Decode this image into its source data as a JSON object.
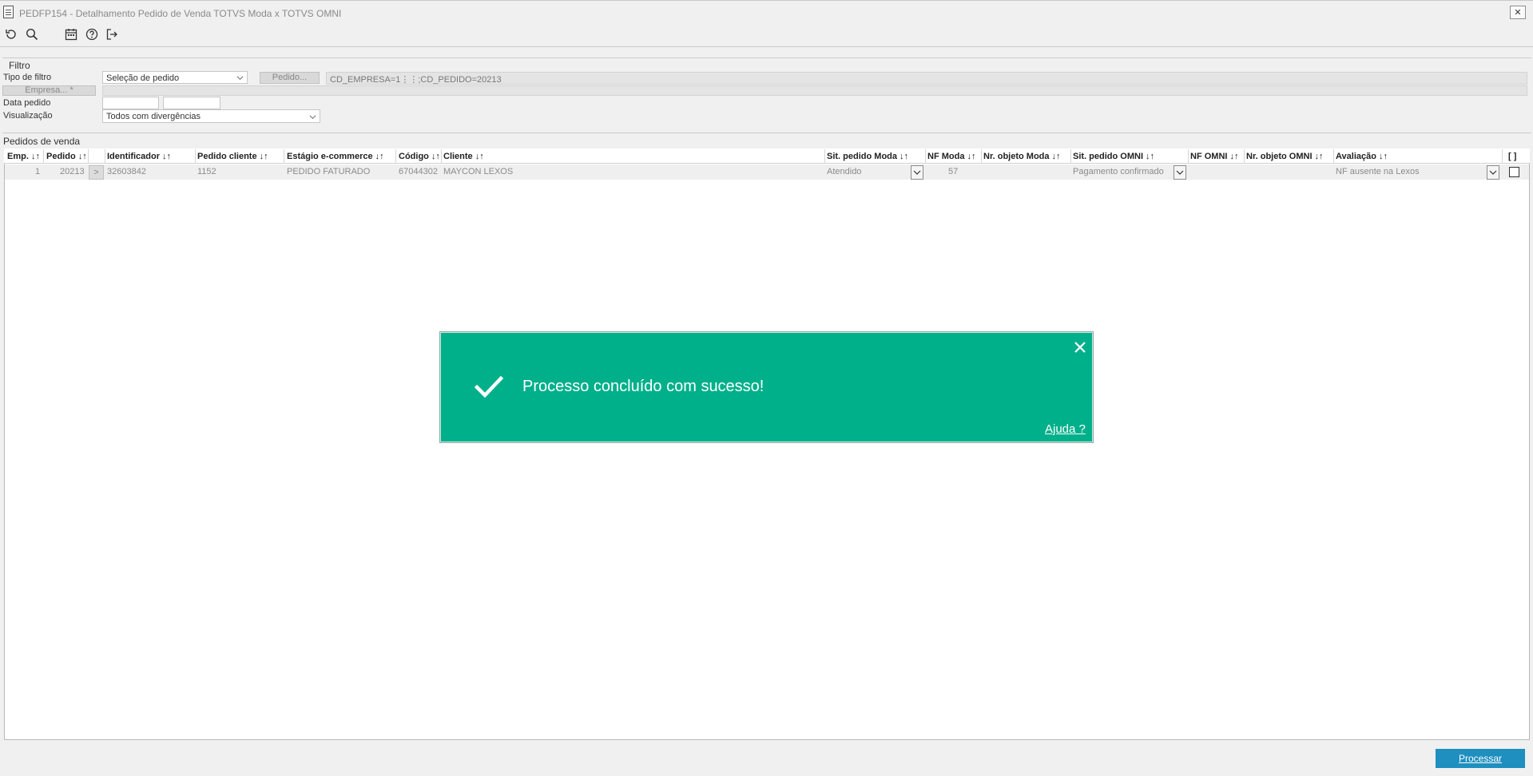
{
  "window": {
    "title": "PEDFP154 - Detalhamento Pedido de Venda TOTVS Moda x TOTVS OMNI",
    "close_glyph": "✕"
  },
  "toolbar": {
    "icons": [
      "refresh-icon",
      "search-icon",
      "calendar-icon",
      "help-circle-icon",
      "exit-icon"
    ]
  },
  "filter": {
    "section_title": "Filtro",
    "tipo_filtro_label": "Tipo de filtro",
    "tipo_filtro_value": "Seleção de pedido",
    "pedido_button": "Pedido...",
    "pedido_expression": "CD_EMPRESA=1⋮⋮;CD_PEDIDO=20213",
    "empresa_button": "Empresa... *",
    "data_pedido_label": "Data pedido",
    "visualizacao_label": "Visualização",
    "visualizacao_value": "Todos com divergências"
  },
  "grid": {
    "section_title": "Pedidos de venda",
    "columns": [
      "Emp. ↓↑",
      "Pedido ↓↑",
      "Identificador ↓↑",
      "Pedido cliente ↓↑",
      "Estágio e-commerce ↓↑",
      "Código ↓↑",
      "Cliente ↓↑",
      "Sit. pedido Moda ↓↑",
      "NF Moda ↓↑",
      "Nr. objeto Moda ↓↑",
      "Sit. pedido OMNI ↓↑",
      "NF OMNI ↓↑",
      "Nr. objeto OMNI ↓↑",
      "Avaliação ↓↑",
      "[ ]"
    ],
    "rows": [
      {
        "emp": "1",
        "pedido": "20213",
        "expand": ">",
        "identificador": "32603842",
        "pedido_cliente": "1152",
        "estagio": "PEDIDO FATURADO",
        "codigo": "67044302",
        "cliente": "MAYCON LEXOS",
        "sit_moda": "Atendido",
        "nf_moda": "57",
        "nr_obj_moda": "",
        "sit_omni": "Pagamento confirmado",
        "nf_omni": "",
        "nr_obj_omni": "",
        "avaliacao": "NF ausente na Lexos",
        "checked": false
      }
    ]
  },
  "toast": {
    "message": "Processo concluído com sucesso!",
    "help_link": "Ajuda ?",
    "color": "#00b08b"
  },
  "footer": {
    "process_button": "Processar",
    "button_color": "#1e8fbf"
  }
}
